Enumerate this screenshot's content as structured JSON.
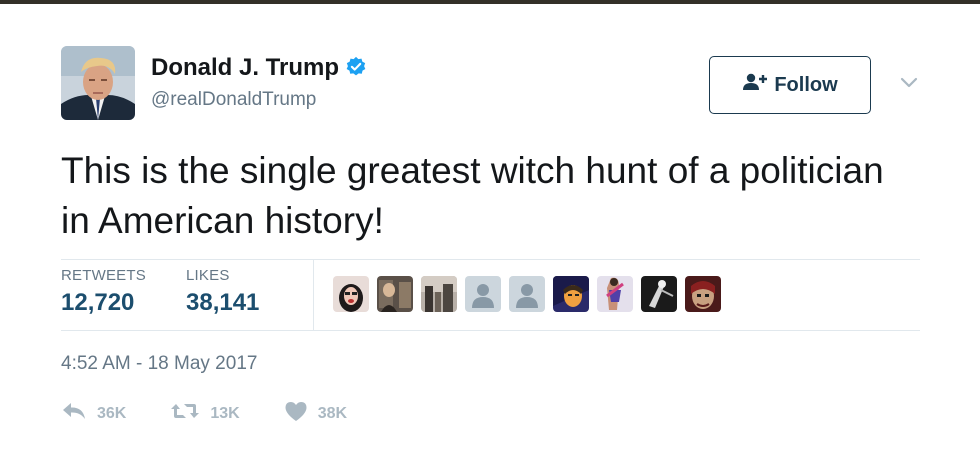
{
  "user": {
    "name": "Donald J. Trump",
    "handle": "@realDonaldTrump",
    "verified": true
  },
  "follow_button": {
    "label": "Follow",
    "icon": "add-user-icon"
  },
  "menu_icon": "chevron-down-icon",
  "tweet": {
    "text": "This is the single greatest witch hunt of a politician in American history!",
    "timestamp": "4:52 AM - 18 May 2017"
  },
  "stats": {
    "retweets_label": "RETWEETS",
    "retweets_value": "12,720",
    "likes_label": "LIKES",
    "likes_value": "38,141"
  },
  "likers_count": 9,
  "actions": {
    "reply_count": "36K",
    "retweet_count": "13K",
    "like_count": "38K"
  },
  "colors": {
    "verified_blue": "#1da1f2",
    "follow_border": "#1b3a4f",
    "stat_value": "#1c4e6e",
    "muted_text": "#657786",
    "action_gray": "#aab8c2"
  }
}
